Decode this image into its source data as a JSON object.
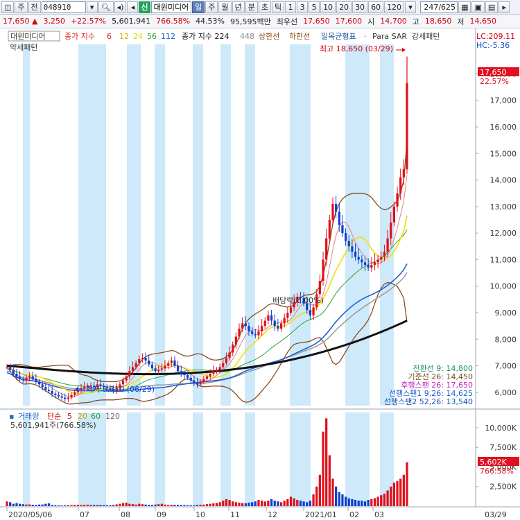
{
  "toolbar": {
    "items": [
      {
        "name": "layout-icon",
        "label": "◫"
      },
      {
        "name": "stock-type-select",
        "label": "주"
      },
      {
        "name": "market-select",
        "label": "전"
      }
    ],
    "code": "048910",
    "stock_name": "대원미디어",
    "shin_tag": "신",
    "periods": [
      "일",
      "주",
      "월",
      "년",
      "분",
      "초",
      "틱"
    ],
    "active_period": "일",
    "intervals": [
      "1",
      "3",
      "5",
      "10",
      "20",
      "30",
      "60",
      "120"
    ],
    "counter": "247/625"
  },
  "pricebar": {
    "price": "17,650 ▲",
    "change": "3,250",
    "change_pct": "+22.57%",
    "volume": "5,601,941",
    "volume_ratio": "766.58%",
    "turnover": "44.53%",
    "amount": "95,595백만",
    "priority": "최우선",
    "ask": "17,650",
    "bid": "17,600",
    "open_label": "시",
    "open": "14,700",
    "high_label": "고",
    "high": "18,650",
    "low_label": "저",
    "low": "14,650"
  },
  "legend": {
    "name": "대원미디어",
    "ma_label": "종가 지수",
    "ma_periods": [
      "6",
      "12",
      "24",
      "56",
      "112"
    ],
    "ma_colors": [
      "#e02020",
      "#f0c000",
      "#f0f000",
      "#30a030",
      "#1060d0"
    ],
    "ma2_label": "종가 지수 224",
    "ma2_period": "448",
    "upper_band": "상한선",
    "lower_band": "하한선",
    "ichimoku": "일목균형표",
    "sar": "Para SAR",
    "pattern": "강세패턴",
    "pattern2": "약세패턴",
    "lc": "LC:209.11",
    "hc": "HC:-5.36"
  },
  "annotations": {
    "high_note": "최고 18,650 (03/29)",
    "low_note": "최저 5,710 (06/29)",
    "dividend_note": "배당락(0.00%)",
    "current_price": "17,650",
    "current_pct": "22.57%"
  },
  "ichimoku_values": [
    {
      "label": "전환선 9: 14,800",
      "color": "#209060"
    },
    {
      "label": "기준선 26: 14,450",
      "color": "#7a4a20"
    },
    {
      "label": "후행스팬 26: 17,650",
      "color": "#c020c0"
    },
    {
      "label": "선행스팬1 9,26: 14,625",
      "color": "#2060d0"
    },
    {
      "label": "선행스팬2 52,26: 13,540",
      "color": "#1050b0"
    }
  ],
  "volume_legend": {
    "label": "거래량",
    "ma_label": "단순",
    "periods": [
      "5",
      "20",
      "60",
      "120"
    ],
    "period_colors": [
      "#d40000",
      "#d8a000",
      "#2a9a40",
      "#666666"
    ],
    "volume_text": "5,601,941주(766.58%)",
    "current_badge": "5,602K",
    "current_pct": "766.58%"
  },
  "price_axis": [
    "18,000",
    "17,000",
    "16,000",
    "15,000",
    "14,000",
    "13,000",
    "12,000",
    "11,000",
    "10,000",
    "9,000",
    "8,000",
    "7,000",
    "6,000"
  ],
  "volume_axis": [
    "10,000K",
    "7,500K",
    "5,000K",
    "2,500K"
  ],
  "date_axis": [
    "2020/05/06",
    "07",
    "08",
    "09",
    "10",
    "11",
    "12",
    "2021/01",
    "02",
    "03",
    "03/29"
  ],
  "colors": {
    "up": "#e0101a",
    "down": "#1040d0",
    "shade": "#cde9fa",
    "badge": "#e01020"
  },
  "chart_data": {
    "type": "candlestick",
    "x_range": [
      "2020/05/06",
      "2021/03/29"
    ],
    "ylim": [
      5500,
      18900
    ],
    "close": [
      6950,
      6850,
      6700,
      6600,
      6500,
      6450,
      6550,
      6600,
      6500,
      6400,
      6300,
      6200,
      6100,
      6050,
      5950,
      5900,
      5850,
      5800,
      5750,
      5800,
      5900,
      6000,
      6100,
      6150,
      6200,
      6250,
      6250,
      6200,
      6300,
      6250,
      6200,
      6150,
      6100,
      6050,
      6150,
      6300,
      6450,
      6600,
      6800,
      6950,
      7100,
      7250,
      7300,
      7200,
      7050,
      6900,
      6800,
      6850,
      6900,
      7000,
      7100,
      7200,
      7000,
      6800,
      6700,
      6650,
      6550,
      6450,
      6350,
      6300,
      6400,
      6500,
      6600,
      6700,
      6800,
      6850,
      6950,
      7100,
      7300,
      7500,
      7800,
      8100,
      8400,
      8600,
      8500,
      8300,
      8200,
      8150,
      8300,
      8500,
      8700,
      8900,
      8700,
      8500,
      8400,
      8600,
      8800,
      9000,
      9200,
      9400,
      9600,
      9550,
      9350,
      9100,
      8900,
      9200,
      9700,
      10200,
      11000,
      11800,
      12500,
      13100,
      12800,
      12300,
      12000,
      11700,
      11500,
      11300,
      11100,
      11000,
      10900,
      10800,
      10700,
      10800,
      10900,
      11000,
      11100,
      11300,
      11800,
      12400,
      13000,
      13500,
      14100,
      14400,
      17650
    ],
    "volume_k": [
      600,
      500,
      300,
      400,
      300,
      250,
      200,
      220,
      180,
      150,
      200,
      210,
      300,
      350,
      150,
      120,
      100,
      80,
      100,
      120,
      140,
      160,
      180,
      150,
      160,
      180,
      170,
      150,
      160,
      150,
      140,
      130,
      120,
      150,
      220,
      300,
      400,
      450,
      300,
      250,
      200,
      300,
      250,
      200,
      180,
      160,
      200,
      250,
      300,
      200,
      150,
      180,
      170,
      160,
      150,
      140,
      120,
      110,
      100,
      150,
      180,
      200,
      250,
      300,
      350,
      400,
      500,
      700,
      900,
      800,
      600,
      500,
      450,
      400,
      380,
      450,
      500,
      600,
      800,
      700,
      600,
      700,
      900,
      700,
      600,
      500,
      700,
      900,
      1200,
      1000,
      800,
      700,
      600,
      500,
      700,
      1500,
      2500,
      4000,
      9500,
      11200,
      6500,
      3500,
      2500,
      1800,
      1500,
      1200,
      1000,
      900,
      800,
      700,
      700,
      600,
      800,
      900,
      1000,
      1200,
      1400,
      1600,
      2000,
      2500,
      3000,
      3200,
      3500,
      4000,
      5602
    ]
  }
}
